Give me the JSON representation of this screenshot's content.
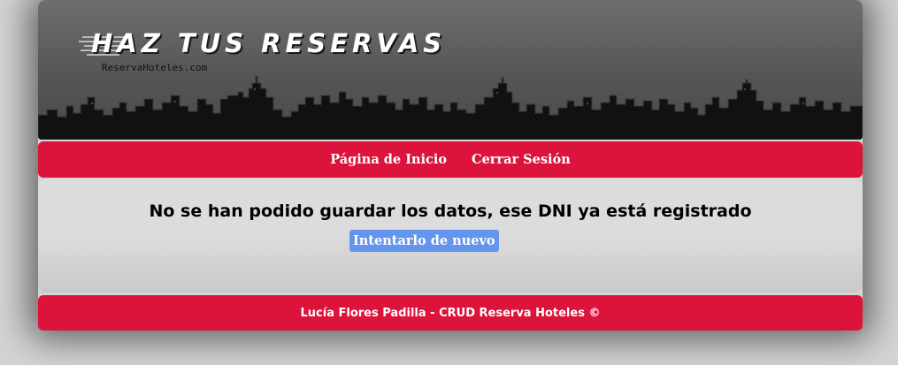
{
  "header": {
    "title": "HAZ TUS RESERVAS",
    "subtitle": "ReservaHoteles.com"
  },
  "nav": {
    "home_label": "Página de Inicio",
    "logout_label": "Cerrar Sesión"
  },
  "main": {
    "message": "No se han podido guardar los datos, ese DNI ya está registrado",
    "retry_label": "Intentarlo de nuevo"
  },
  "footer": {
    "text": "Lucía Flores Padilla - CRUD Reserva Hoteles ©"
  },
  "colors": {
    "accent": "#dc143c",
    "button": "#6495ed",
    "background": "#d4d4d4"
  }
}
